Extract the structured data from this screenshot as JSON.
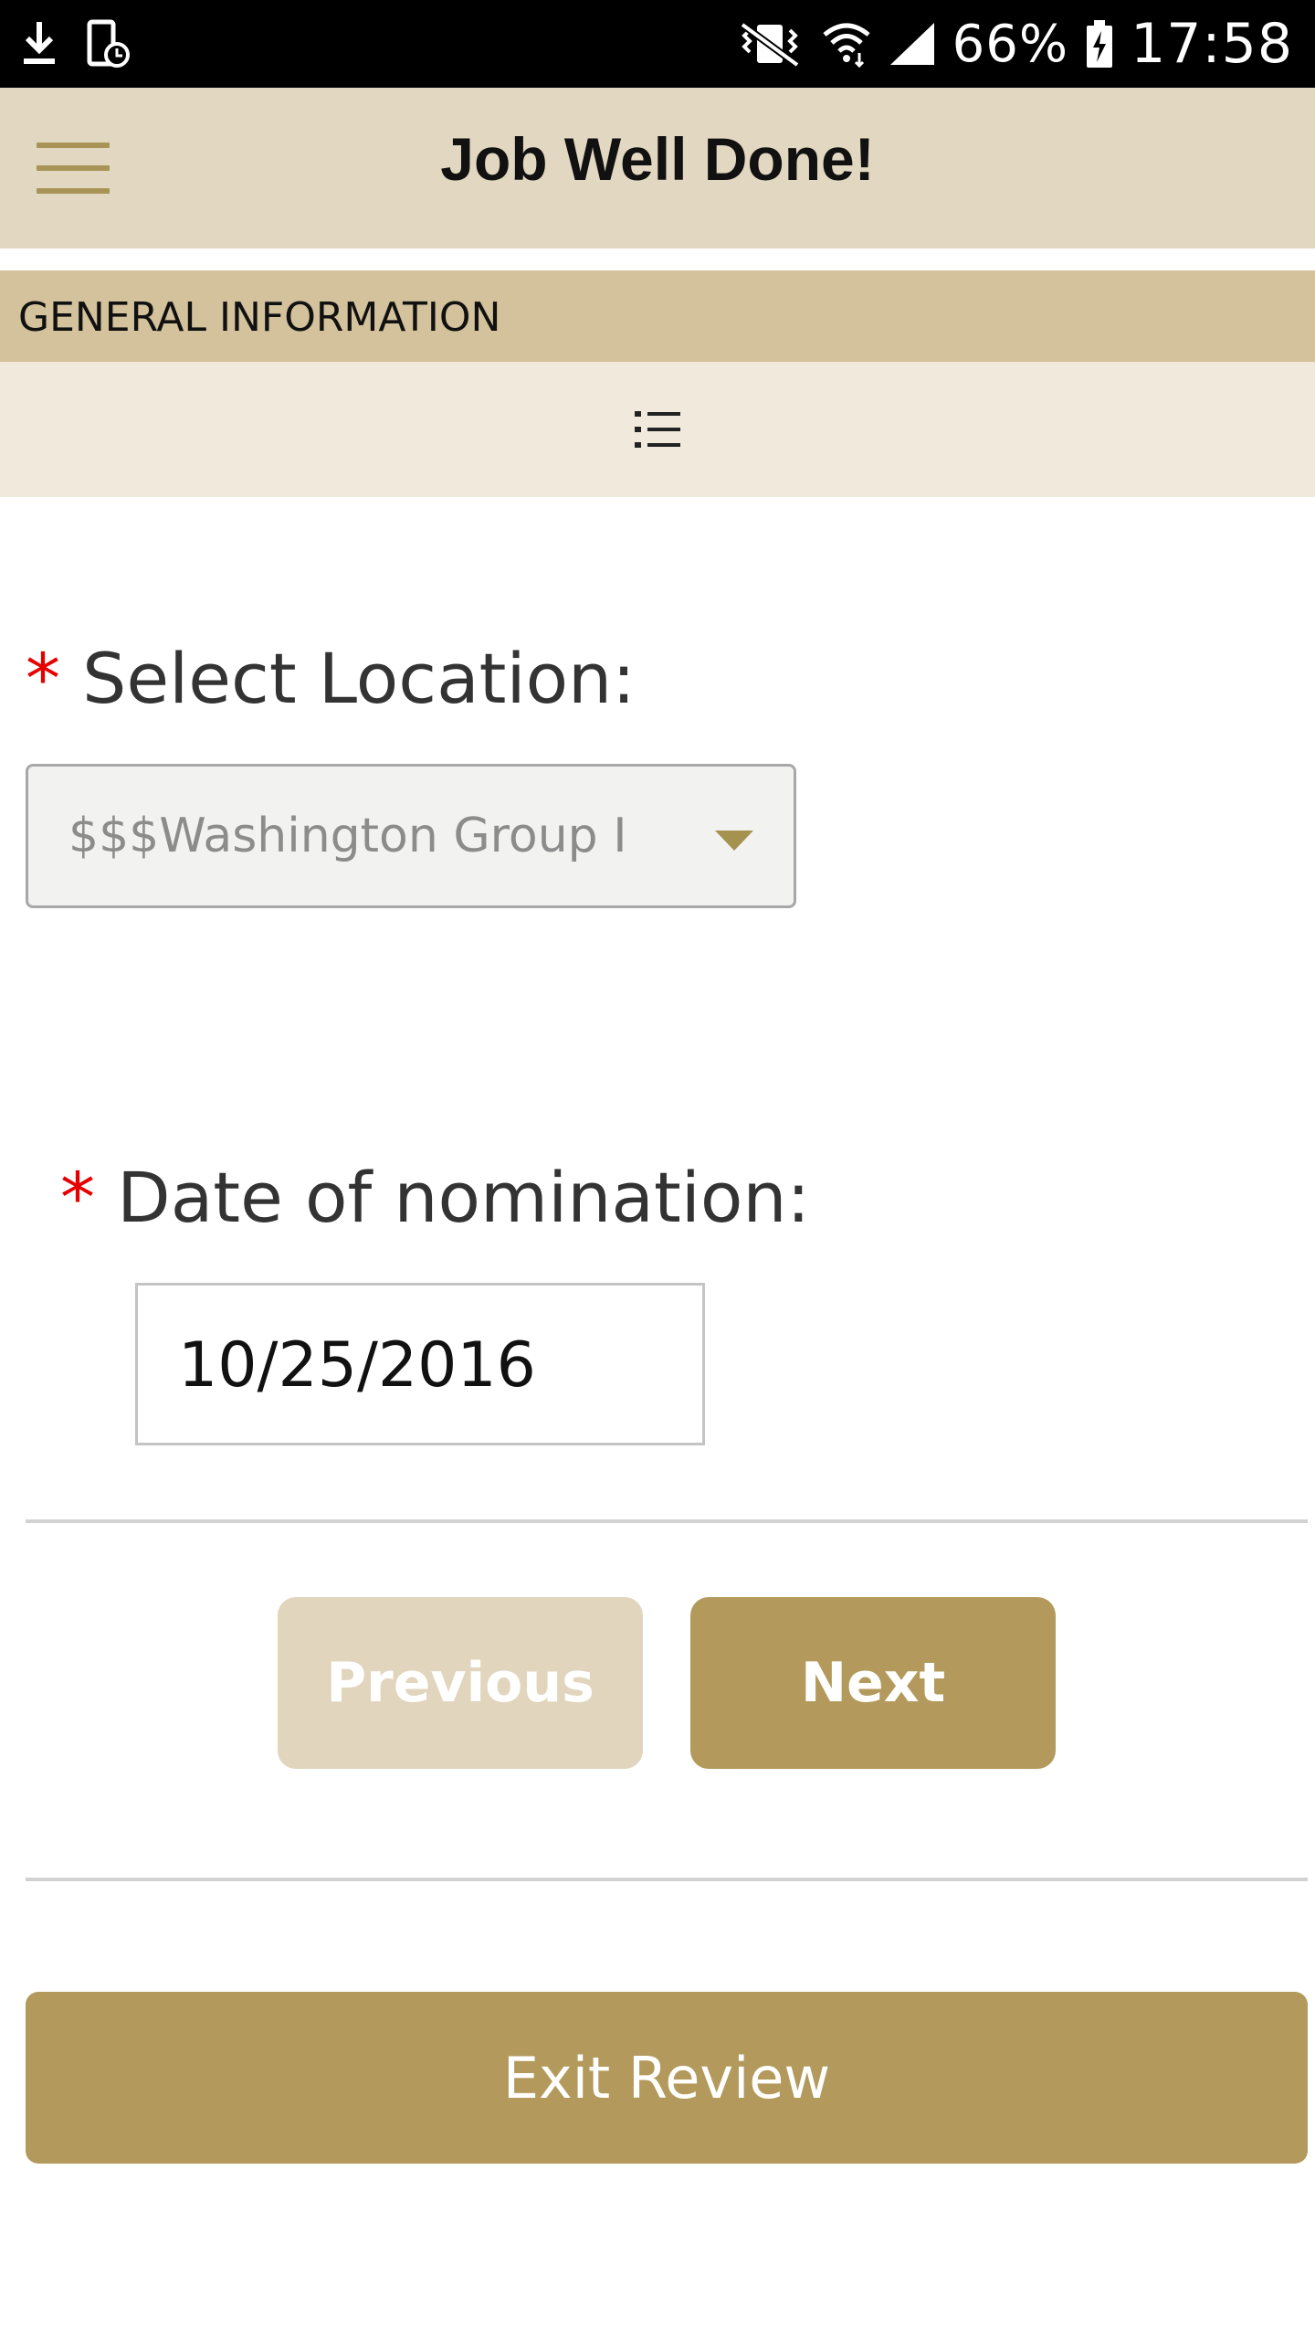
{
  "status_bar": {
    "battery_percent": "66%",
    "time": "17:58",
    "icons": [
      "download-icon",
      "device-lock-icon",
      "vibrate-icon",
      "wifi-icon",
      "signal-icon",
      "battery-charging-icon"
    ]
  },
  "header": {
    "title": "Job Well Done!",
    "menu_icon": "hamburger-menu-icon"
  },
  "section": {
    "title": "GENERAL INFORMATION",
    "toc_icon": "list-icon"
  },
  "form": {
    "required_marker": "*",
    "location": {
      "label": "Select Location:",
      "value": "$$$Washington Group I"
    },
    "date": {
      "label": "Date of nomination:",
      "value": "10/25/2016"
    }
  },
  "buttons": {
    "previous": "Previous",
    "next": "Next",
    "exit": "Exit Review"
  },
  "colors": {
    "header_bg": "#e2d7c1",
    "section_bg": "#d3c29c",
    "toc_bg": "#f1e9db",
    "primary_button": "#b39a5c",
    "disabled_button": "#e1d5bd",
    "required": "#e60000"
  }
}
